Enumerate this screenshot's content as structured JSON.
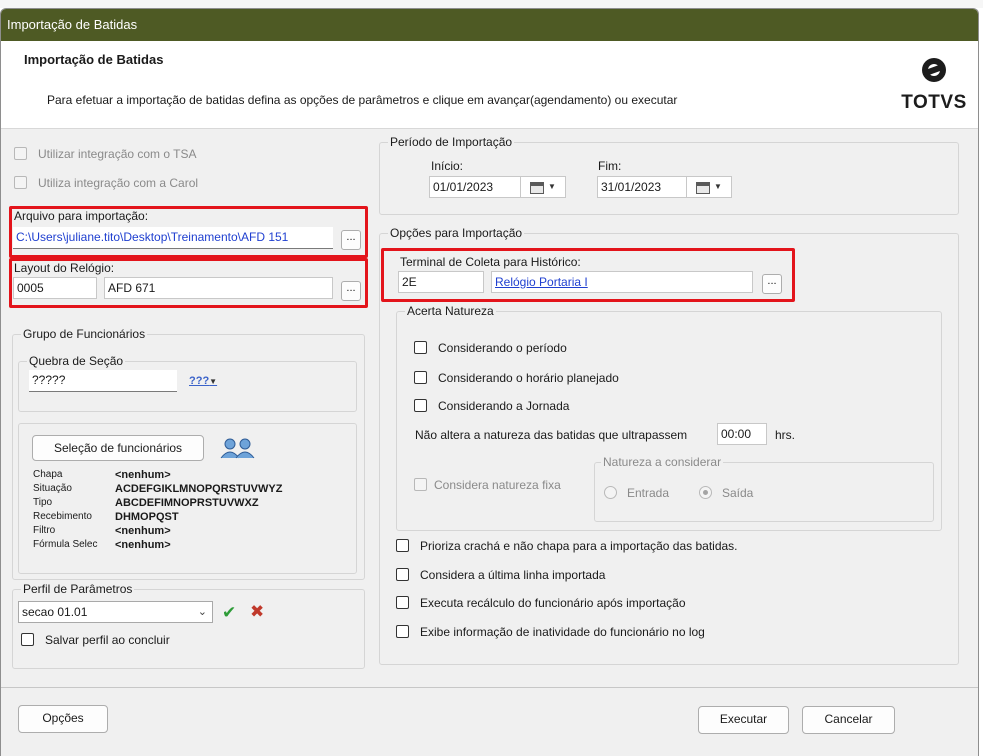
{
  "window": {
    "title": "Importação de Batidas"
  },
  "header": {
    "title": "Importação de Batidas",
    "description": "Para efetuar a importação de batidas defina as opções de parâmetros e clique em avançar(agendamento) ou executar",
    "logo_text": "TOTVS"
  },
  "left": {
    "tsa_checkbox": "Utilizar integração com o TSA",
    "carol_checkbox": "Utiliza integração com a Carol",
    "arquivo": {
      "label": "Arquivo para importação:",
      "value": "C:\\Users\\juliane.tito\\Desktop\\Treinamento\\AFD 151",
      "browse": "..."
    },
    "layout": {
      "label": "Layout do Relógio:",
      "code": "0005",
      "name": "AFD 671",
      "browse": "..."
    },
    "grupo": {
      "legend": "Grupo de Funcionários",
      "quebra_legend": "Quebra de Seção",
      "quebra_value": "?????",
      "quebra_btn": "???",
      "selecao_btn": "Seleção de funcionários",
      "rows": [
        {
          "label": "Chapa",
          "value": "<nenhum>"
        },
        {
          "label": "Situação",
          "value": "ACDEFGIKLMNOPQRSTUVWYZ"
        },
        {
          "label": "Tipo",
          "value": "ABCDEFIMNOPRSTUVWXZ"
        },
        {
          "label": "Recebimento",
          "value": "DHMOPQST"
        },
        {
          "label": "Filtro",
          "value": "<nenhum>"
        },
        {
          "label": "Fórmula Selec",
          "value": "<nenhum>"
        }
      ]
    },
    "perfil": {
      "legend": "Perfil de Parâmetros",
      "value": "secao 01.01",
      "salvar": "Salvar perfil ao concluir"
    }
  },
  "right": {
    "periodo": {
      "legend": "Período de Importação",
      "inicio_label": "Início:",
      "inicio_value": "01/01/2023",
      "fim_label": "Fim:",
      "fim_value": "31/01/2023"
    },
    "opcoes": {
      "legend": "Opções para Importação",
      "terminal_label": "Terminal de Coleta para Histórico:",
      "terminal_code": "2E",
      "terminal_name": "Relógio Portaria I",
      "terminal_browse": "...",
      "acerta": {
        "legend": "Acerta Natureza",
        "opt1": "Considerando o período",
        "opt2": "Considerando o horário planejado",
        "opt3": "Considerando a Jornada",
        "nao_altera": "Não altera a natureza das batidas que ultrapassem",
        "hours_value": "00:00",
        "hrs": "hrs.",
        "fixa": "Considera natureza fixa",
        "natureza_legend": "Natureza a considerar",
        "entrada": "Entrada",
        "saida": "Saída"
      },
      "prioriza": "Prioriza crachá e não chapa para a importação das batidas.",
      "ultima": "Considera a última linha importada",
      "recalculo": "Executa recálculo do funcionário após importação",
      "inatividade": "Exibe informação de inatividade do funcionário no log"
    }
  },
  "footer": {
    "opcoes": "Opções",
    "executar": "Executar",
    "cancelar": "Cancelar"
  },
  "colors": {
    "titlebar": "#4e5a24",
    "highlight": "#e3141b",
    "link": "#1f3fd0"
  }
}
